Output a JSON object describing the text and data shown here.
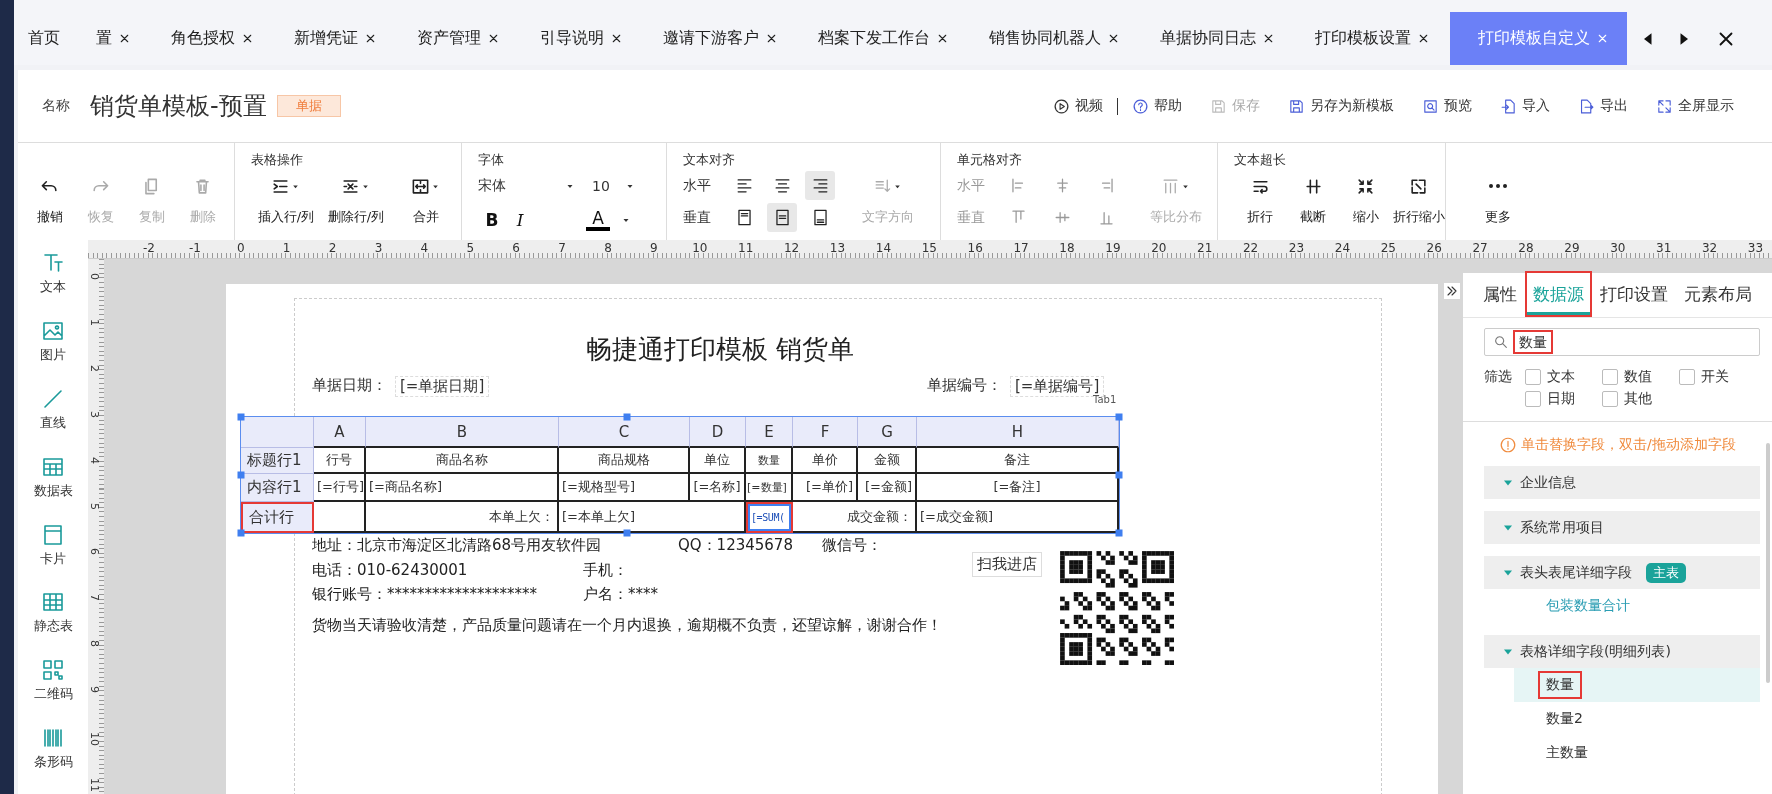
{
  "tabs": [
    {
      "label": "首页",
      "closable": false,
      "selected": false
    },
    {
      "label": "置",
      "closable": true,
      "selected": false
    },
    {
      "label": "角色授权",
      "closable": true,
      "selected": false
    },
    {
      "label": "新增凭证",
      "closable": true,
      "selected": false
    },
    {
      "label": "资产管理",
      "closable": true,
      "selected": false
    },
    {
      "label": "引导说明",
      "closable": true,
      "selected": false
    },
    {
      "label": "邀请下游客户",
      "closable": true,
      "selected": false
    },
    {
      "label": "档案下发工作台",
      "closable": true,
      "selected": false
    },
    {
      "label": "销售协同机器人",
      "closable": true,
      "selected": false
    },
    {
      "label": "单据协同日志",
      "closable": true,
      "selected": false
    },
    {
      "label": "打印模板设置",
      "closable": true,
      "selected": false
    },
    {
      "label": "打印模板自定义",
      "closable": true,
      "selected": true
    }
  ],
  "header": {
    "name_label": "名称",
    "title": "销货单模板-预置",
    "badge": "单据",
    "actions": [
      {
        "label": "视频",
        "disabled": false
      },
      {
        "label": "帮助",
        "disabled": false
      },
      {
        "label": "保存",
        "disabled": true
      },
      {
        "label": "另存为新模板",
        "disabled": false
      },
      {
        "label": "预览",
        "disabled": false
      },
      {
        "label": "导入",
        "disabled": false
      },
      {
        "label": "导出",
        "disabled": false
      },
      {
        "label": "全屏显示",
        "disabled": false
      }
    ]
  },
  "toolbar": [
    {
      "kind": "buttons",
      "items": [
        {
          "label": "撤销",
          "dropdown": false,
          "disabled": false
        },
        {
          "label": "恢复",
          "dropdown": false,
          "disabled": true
        },
        {
          "label": "复制",
          "dropdown": false,
          "disabled": true
        },
        {
          "label": "删除",
          "dropdown": false,
          "disabled": true
        }
      ]
    },
    {
      "kind": "buttons",
      "title": "表格操作",
      "items": [
        {
          "label": "插入行/列",
          "dropdown": true,
          "disabled": false
        },
        {
          "label": "删除行/列",
          "dropdown": true,
          "disabled": false
        },
        {
          "label": "合并",
          "dropdown": true,
          "disabled": false
        }
      ]
    },
    {
      "kind": "font",
      "title": "字体",
      "family": "宋体",
      "size": "10",
      "bold": "B",
      "italic": "I",
      "color_label": "A"
    },
    {
      "kind": "align",
      "title": "文本对齐",
      "disabled": false,
      "rows": [
        {
          "label": "水平",
          "options": [
            {
              "selected": false
            },
            {
              "selected": false
            },
            {
              "selected": true
            }
          ]
        },
        {
          "label": "垂直",
          "options": [
            {
              "selected": false
            },
            {
              "selected": true
            },
            {
              "selected": false
            }
          ]
        }
      ],
      "extra": {
        "label": "文字方向",
        "disabled": true
      }
    },
    {
      "kind": "align",
      "title": "单元格对齐",
      "disabled": true,
      "rows": [
        {
          "label": "水平",
          "options": [
            {
              "selected": false
            },
            {
              "selected": false
            },
            {
              "selected": false
            }
          ]
        },
        {
          "label": "垂直",
          "options": [
            {
              "selected": false
            },
            {
              "selected": false
            },
            {
              "selected": false
            }
          ]
        }
      ],
      "extra": {
        "label": "等比分布",
        "disabled": true
      }
    },
    {
      "kind": "buttons",
      "title": "文本超长",
      "items": [
        {
          "label": "折行",
          "dropdown": false,
          "disabled": false
        },
        {
          "label": "截断",
          "dropdown": false,
          "disabled": false
        },
        {
          "label": "缩小",
          "dropdown": false,
          "disabled": false
        },
        {
          "label": "折行缩小",
          "dropdown": false,
          "disabled": false
        }
      ]
    },
    {
      "kind": "buttons",
      "items": [
        {
          "label": "更多",
          "dropdown": false,
          "disabled": false
        }
      ]
    }
  ],
  "ruler": {
    "labels": [
      "-2",
      "-1",
      "0",
      "1",
      "2",
      "3",
      "4",
      "5",
      "6",
      "7",
      "8",
      "9",
      "10",
      "11",
      "12",
      "13",
      "14",
      "15",
      "16",
      "17",
      "18",
      "19",
      "20",
      "21",
      "22",
      "23",
      "24",
      "25",
      "26",
      "27",
      "28",
      "29",
      "30",
      "31",
      "32",
      "33"
    ]
  },
  "vertical_ruler": {
    "labels": [
      "0",
      "1",
      "2",
      "3",
      "4",
      "5",
      "6",
      "7",
      "8",
      "9",
      "10",
      "11"
    ]
  },
  "tools": [
    {
      "label": "文本"
    },
    {
      "label": "图片"
    },
    {
      "label": "直线"
    },
    {
      "label": "数据表"
    },
    {
      "label": "卡片"
    },
    {
      "label": "静态表"
    },
    {
      "label": "二维码"
    },
    {
      "label": "条形码"
    }
  ],
  "document": {
    "title": "畅捷通打印模板 销货单",
    "fields": [
      {
        "label": "单据日期：",
        "value": "[=单据日期]"
      },
      {
        "label": "单据编号：",
        "value": "[=单据编号]"
      }
    ],
    "table_name": "Tab1",
    "table": {
      "columns": [
        "A",
        "B",
        "C",
        "D",
        "E",
        "F",
        "G",
        "H"
      ],
      "rows": [
        {
          "label": "标题行1",
          "highlighted": false,
          "cells": [
            {
              "text": "行号",
              "selected": false,
              "highlighted": false
            },
            {
              "text": "商品名称",
              "selected": false,
              "highlighted": false
            },
            {
              "text": "商品规格",
              "selected": false,
              "highlighted": false
            },
            {
              "text": "单位",
              "selected": false,
              "highlighted": false
            },
            {
              "text": "数量",
              "selected": false,
              "highlighted": false
            },
            {
              "text": "单价",
              "selected": false,
              "highlighted": false
            },
            {
              "text": "金额",
              "selected": false,
              "highlighted": false
            },
            {
              "text": "备注",
              "selected": false,
              "highlighted": false
            }
          ]
        },
        {
          "label": "内容行1",
          "highlighted": false,
          "cells": [
            {
              "text": "[=行号]",
              "selected": false,
              "highlighted": false
            },
            {
              "text": "[=商品名称]",
              "selected": false,
              "highlighted": false
            },
            {
              "text": "[=规格型号]",
              "selected": false,
              "highlighted": false
            },
            {
              "text": "[=名称]",
              "selected": false,
              "highlighted": false
            },
            {
              "text": "[=数量]",
              "selected": false,
              "highlighted": false
            },
            {
              "text": "[=单价]",
              "selected": false,
              "highlighted": false
            },
            {
              "text": "[=金额]",
              "selected": false,
              "highlighted": false
            },
            {
              "text": "[=备注]",
              "selected": false,
              "highlighted": false
            }
          ]
        },
        {
          "label": "合计行",
          "highlighted": true,
          "cells": [
            {
              "text": "",
              "selected": false,
              "highlighted": false
            },
            {
              "text": "本单上欠：",
              "selected": false,
              "highlighted": false
            },
            {
              "text": "[=本单上欠]",
              "selected": false,
              "highlighted": false
            },
            {
              "text": "",
              "selected": false,
              "highlighted": false
            },
            {
              "text": "[=SUM(",
              "selected": true,
              "highlighted": true
            },
            {
              "text": "",
              "selected": false,
              "highlighted": false
            },
            {
              "text": "成交金额：",
              "selected": false,
              "highlighted": false
            },
            {
              "text": "[=成交金额]",
              "selected": false,
              "highlighted": false
            }
          ]
        }
      ]
    },
    "lines": [
      "地址：北京市海淀区北清路68号用友软件园",
      "QQ：12345678",
      "微信号：",
      "电话：010-62430001",
      "手机：",
      "银行账号：********************",
      "户名：****",
      "货物当天请验收清楚，产品质量问题请在一个月内退换，逾期概不负责，还望谅解，谢谢合作！"
    ],
    "qr_caption": "扫我进店"
  },
  "panel": {
    "tabs": [
      {
        "label": "属性",
        "selected": false,
        "highlighted": false
      },
      {
        "label": "数据源",
        "selected": true,
        "highlighted": true
      },
      {
        "label": "打印设置",
        "selected": false,
        "highlighted": false
      },
      {
        "label": "元素布局",
        "selected": false,
        "highlighted": false
      }
    ],
    "search": {
      "value": "数量",
      "highlighted": true
    },
    "filter": {
      "label": "筛选",
      "options": [
        {
          "label": "文本",
          "checked": false
        },
        {
          "label": "数值",
          "checked": false
        },
        {
          "label": "开关",
          "checked": false
        },
        {
          "label": "日期",
          "checked": false
        },
        {
          "label": "其他",
          "checked": false
        }
      ]
    },
    "hint": "单击替换字段，双击/拖动添加字段",
    "groups": [
      {
        "title": "企业信息",
        "expanded": true
      },
      {
        "title": "系统常用项目",
        "expanded": true
      },
      {
        "title": "表头表尾详细字段",
        "expanded": true,
        "badge": "主表",
        "items": [
          {
            "label": "包装数量合计",
            "color": "#2a9db3",
            "selected": false,
            "highlighted": false
          }
        ]
      },
      {
        "title": "表格详细字段(明细列表)",
        "expanded": true,
        "items": [
          {
            "label": "数量",
            "color": "#333333",
            "selected": true,
            "highlighted": true
          },
          {
            "label": "数量2",
            "color": "#333333",
            "selected": false,
            "highlighted": false
          },
          {
            "label": "主数量",
            "color": "#333333",
            "selected": false,
            "highlighted": false
          }
        ]
      }
    ]
  }
}
